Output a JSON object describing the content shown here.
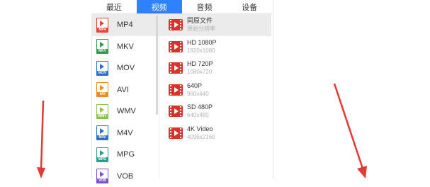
{
  "tabs": [
    {
      "label": "最近",
      "active": false
    },
    {
      "label": "视频",
      "active": true
    },
    {
      "label": "音频",
      "active": false
    },
    {
      "label": "设备",
      "active": false
    }
  ],
  "formats": [
    {
      "name": "MP4",
      "badge": "MP4",
      "color": "#e8413a",
      "selected": true
    },
    {
      "name": "MKV",
      "badge": "MKV",
      "color": "#2e9b4f",
      "selected": false
    },
    {
      "name": "MOV",
      "badge": "MOV",
      "color": "#2c6fd1",
      "selected": false
    },
    {
      "name": "AVI",
      "badge": "AVI",
      "color": "#ee8a24",
      "selected": false
    },
    {
      "name": "WMV",
      "badge": "WMV",
      "color": "#8bc34a",
      "selected": false
    },
    {
      "name": "M4V",
      "badge": "M4V",
      "color": "#2c6fd1",
      "selected": false
    },
    {
      "name": "MPG",
      "badge": "MPG",
      "color": "#2e9b8f",
      "selected": false
    },
    {
      "name": "VOB",
      "badge": "VOB",
      "color": "#7b4fd1",
      "selected": false
    }
  ],
  "resolutions": [
    {
      "name": "同原文件",
      "sub": "原始分辨率",
      "selected": true
    },
    {
      "name": "HD 1080P",
      "sub": "1920x1080",
      "selected": false
    },
    {
      "name": "HD 720P",
      "sub": "1080x720",
      "selected": false
    },
    {
      "name": "640P",
      "sub": "960x640",
      "selected": false
    },
    {
      "name": "SD 480P",
      "sub": "640x480",
      "selected": false
    },
    {
      "name": "4K Video",
      "sub": "4096x2160",
      "selected": false
    }
  ],
  "colors": {
    "accent": "#2f82ff",
    "arrow": "#e53935",
    "resolution_icon": "#d9322b"
  }
}
